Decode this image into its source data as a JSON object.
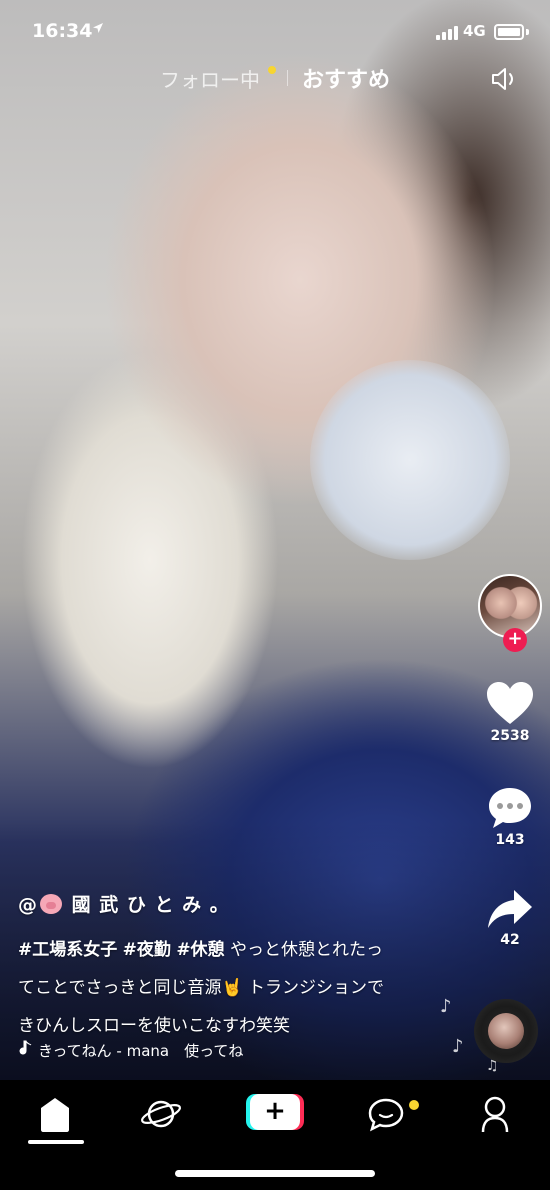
{
  "status_bar": {
    "time": "16:34",
    "location_icon": "location-arrow-icon",
    "network": "4G",
    "battery_icon": "battery-icon"
  },
  "top_tabs": {
    "following_label": "フォロー中",
    "recommended_label": "おすすめ",
    "following_dot_color": "#f7d531",
    "mute_icon": "speaker-muted-icon"
  },
  "side_actions": {
    "follow_plus": "+",
    "likes": "2538",
    "comments": "143",
    "shares": "42",
    "follow_button_color": "#ee1d52"
  },
  "caption": {
    "username_prefix": "@",
    "username": "國 武 ひ と み 。",
    "hashtags": [
      "#工場系女子",
      "#夜勤",
      "#休憩"
    ],
    "line1_text": " やっと休憩とれたっ",
    "line2_text": "てことでさっきと同じ音源🤘 トランジションで",
    "line3_text": "きひんしスローを使いこなすわ笑笑"
  },
  "music": {
    "note_icon": "music-note-icon",
    "text": "きってねん - mana　使ってね"
  },
  "bottom_nav": {
    "home_icon": "home-icon",
    "discover_icon": "planet-icon",
    "create_label": "+",
    "inbox_icon": "inbox-chat-icon",
    "profile_icon": "profile-icon",
    "inbox_dot_color": "#f7d531"
  }
}
